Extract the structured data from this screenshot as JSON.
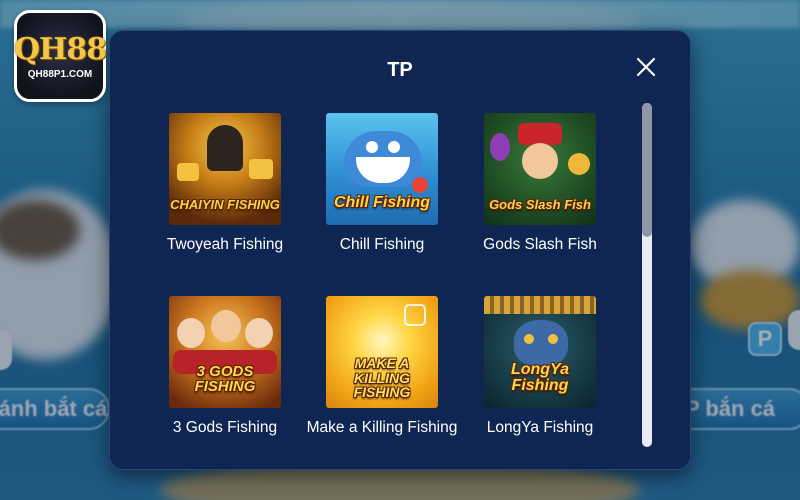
{
  "logo": {
    "mark": "QH88",
    "url": "QH88P1.COM"
  },
  "background": {
    "left_label": "Đánh bắt cá",
    "right_label": "P bắn cá",
    "badge": "P"
  },
  "modal": {
    "title": "TP",
    "close_icon": "close-icon"
  },
  "games": [
    {
      "name": "Twoyeah Fishing",
      "art_text": "CHAIYIN FISHING"
    },
    {
      "name": "Chill Fishing",
      "art_text": "Chill Fishing"
    },
    {
      "name": "Gods Slash Fish",
      "art_text": "Gods Slash Fish"
    },
    {
      "name": "3 Gods Fishing",
      "art_text": "3 GODS FISHING"
    },
    {
      "name": "Make a Killing Fishing",
      "art_text": "MAKE A KILLING FISHING"
    },
    {
      "name": "LongYa Fishing",
      "art_text": "LongYa Fishing"
    }
  ],
  "scrollbar": {
    "position": 0
  }
}
